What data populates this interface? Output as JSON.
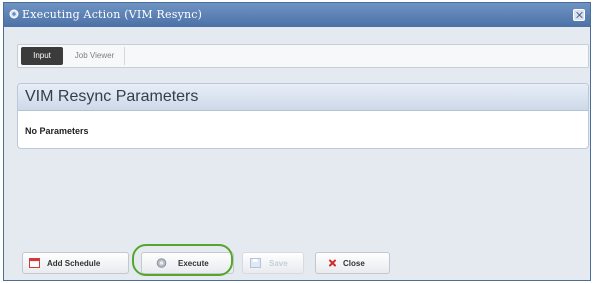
{
  "dialog": {
    "title": "Executing Action (VIM Resync)"
  },
  "tabs": [
    {
      "label": "Input",
      "active": true
    },
    {
      "label": "Job Viewer",
      "active": false
    }
  ],
  "parameters": {
    "heading": "VIM Resync Parameters",
    "message": "No Parameters"
  },
  "buttons": {
    "add_schedule": "Add Schedule",
    "execute": "Execute",
    "save": "Save",
    "close": "Close"
  },
  "icons": {
    "title": "gear-icon",
    "close_window": "close-icon",
    "add_schedule": "calendar-icon",
    "execute": "execute-icon",
    "save": "floppy-disk-icon",
    "close": "x-icon"
  },
  "colors": {
    "title_bar": "#5b80b5",
    "highlight": "#56a62c",
    "close_icon": "#d02b2b"
  }
}
